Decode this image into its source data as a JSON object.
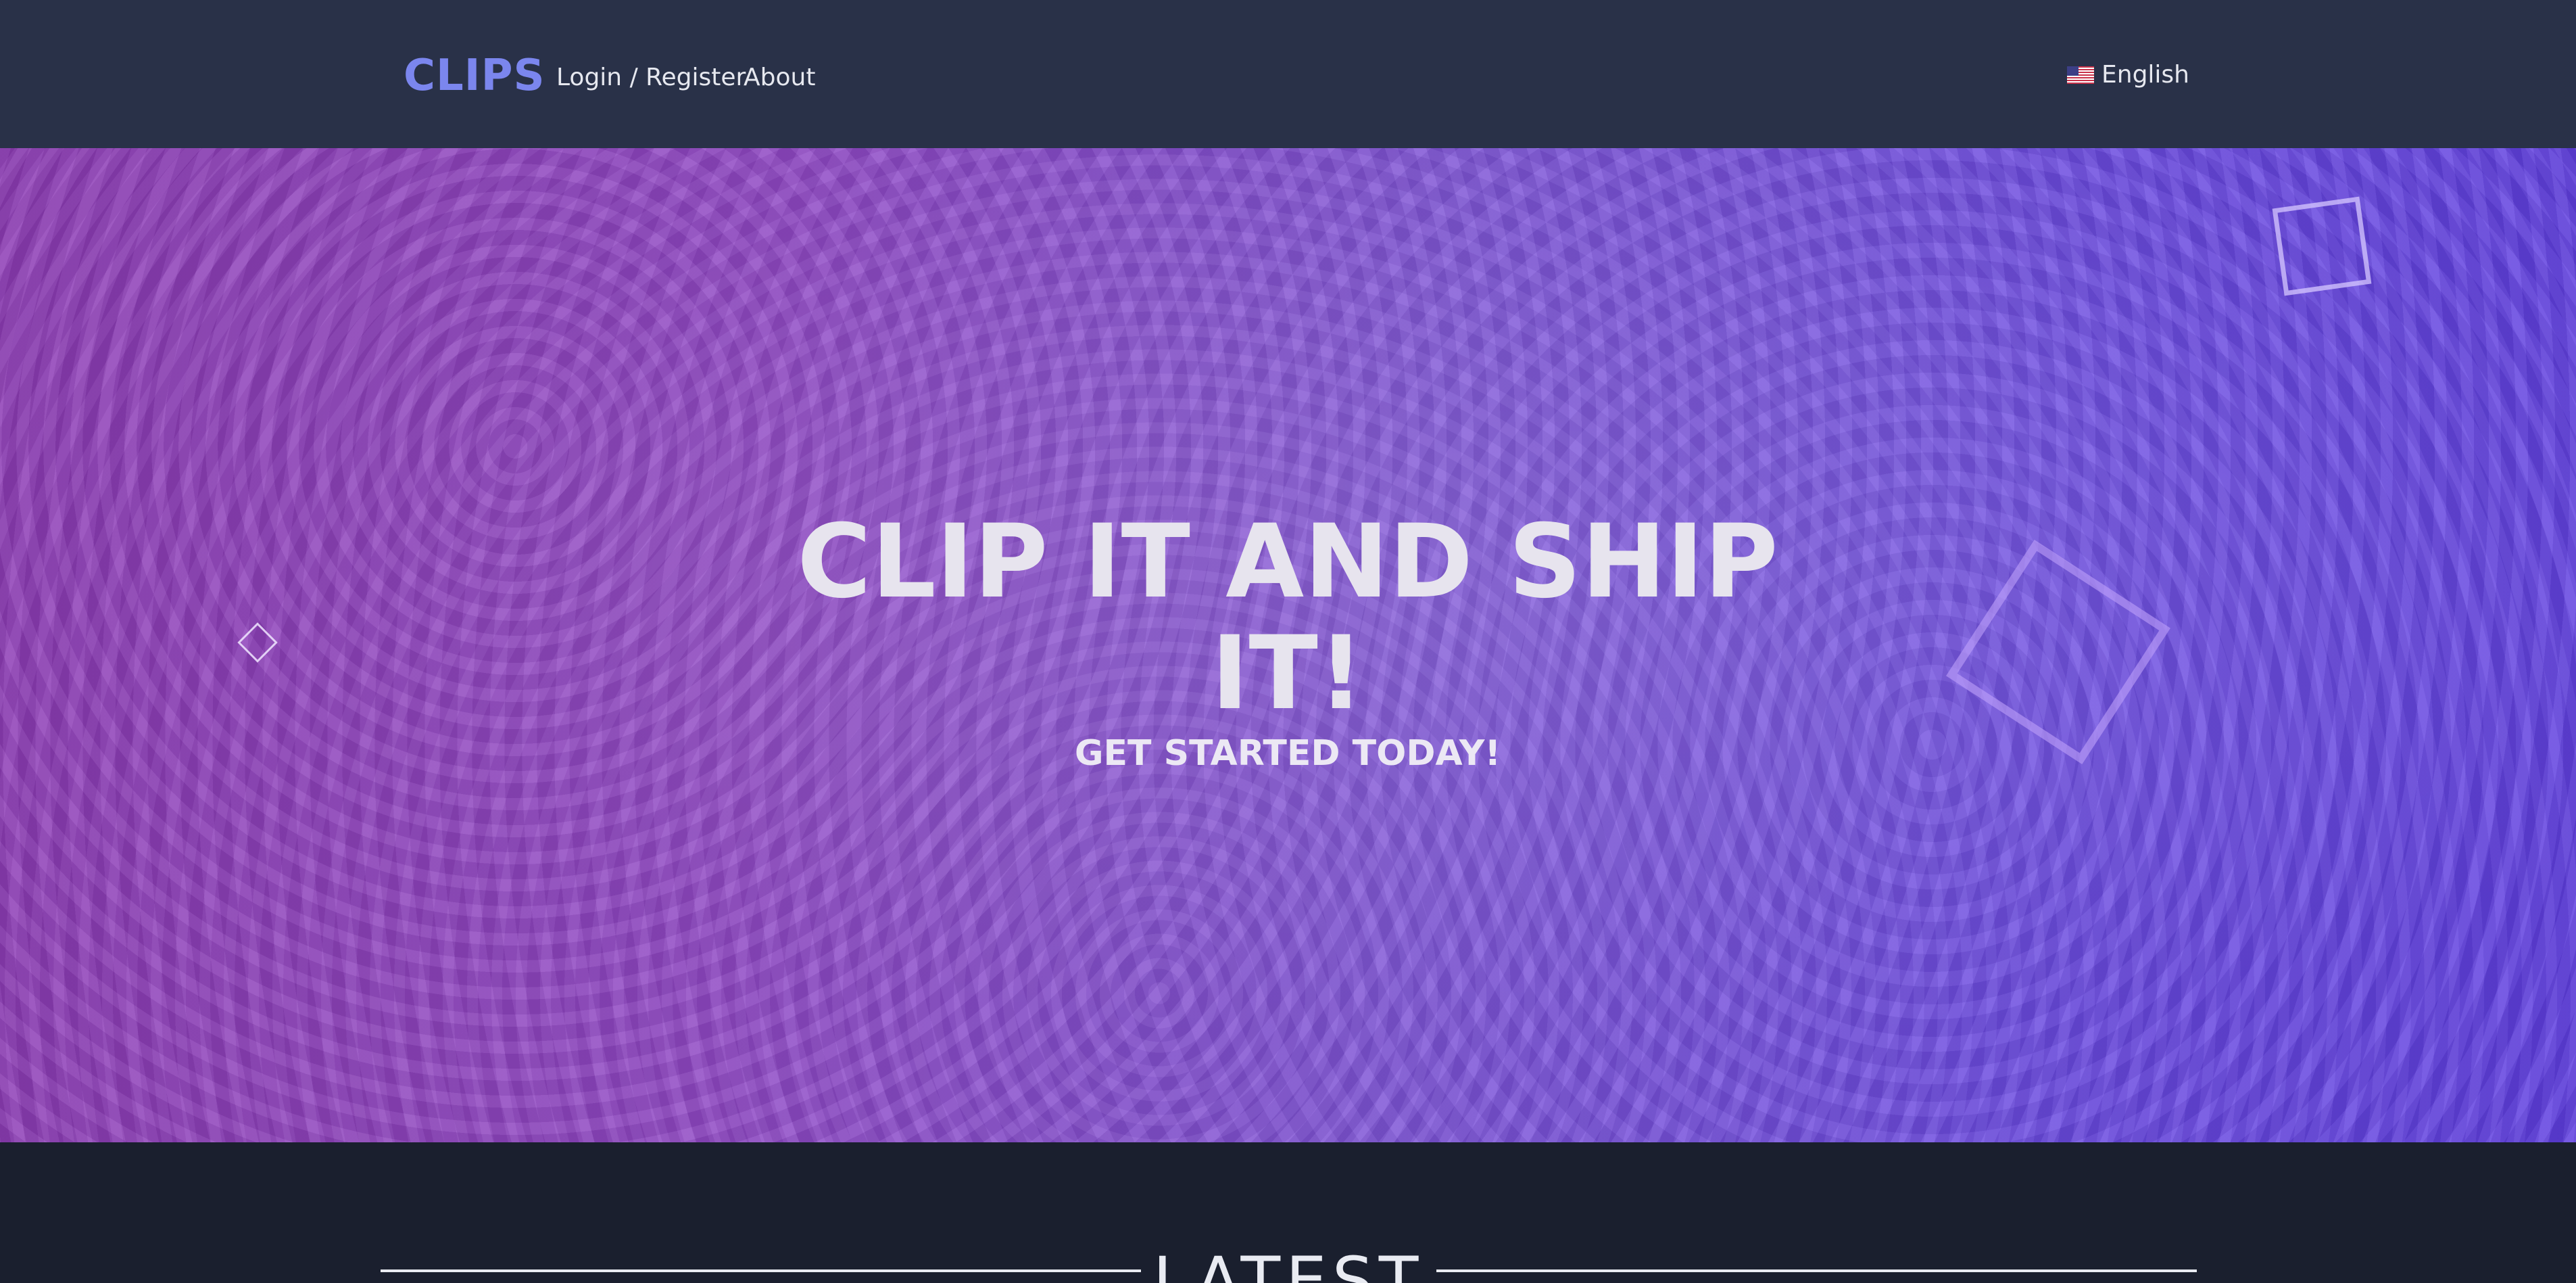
{
  "header": {
    "logo": "CLIPS",
    "nav": {
      "login_register": "Login / Register",
      "about": "About"
    },
    "language": {
      "label": "English",
      "flag_icon": "us-flag-icon"
    }
  },
  "hero": {
    "title": "CLIP IT AND SHIP IT!",
    "subtitle": "GET STARTED TODAY!"
  },
  "latest": {
    "title": "LATEST"
  },
  "colors": {
    "header_bg": "#293148",
    "page_bg": "#1a1f2e",
    "logo": "#7b86ee",
    "hero_gradient_start": "#8c3bb4",
    "hero_gradient_end": "#5e3ddf",
    "text_light": "#e6e8ef"
  }
}
